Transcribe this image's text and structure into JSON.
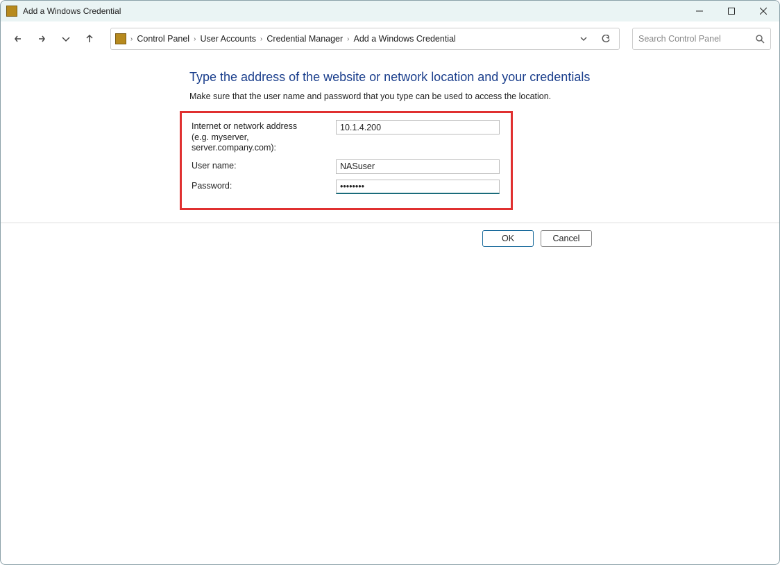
{
  "window": {
    "title": "Add a Windows Credential"
  },
  "breadcrumb": {
    "items": [
      "Control Panel",
      "User Accounts",
      "Credential Manager",
      "Add a Windows Credential"
    ]
  },
  "search": {
    "placeholder": "Search Control Panel"
  },
  "page": {
    "heading": "Type the address of the website or network location and your credentials",
    "subtext": "Make sure that the user name and password that you type can be used to access the location."
  },
  "form": {
    "address_label_line1": "Internet or network address",
    "address_label_line2": "(e.g. myserver, server.company.com):",
    "address_value": "10.1.4.200",
    "username_label": "User name:",
    "username_value": "NASuser",
    "password_label": "Password:",
    "password_value": "••••••••"
  },
  "buttons": {
    "ok": "OK",
    "cancel": "Cancel"
  }
}
